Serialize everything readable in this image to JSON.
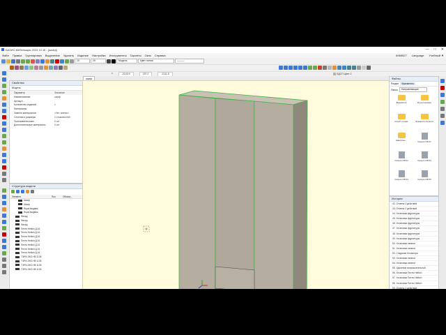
{
  "window": {
    "title": "БАЗИС-Мебельщик 2023 10.16 - [шкаф]",
    "minimize": "—",
    "maximize": "□",
    "close": "✕"
  },
  "menu": {
    "items": [
      "Файл",
      "Правка",
      "Группировка",
      "Выделение",
      "Удалить",
      "Изделие",
      "Настройки",
      "Инструменты",
      "Скрипты",
      "Окно",
      "Справка"
    ],
    "right": [
      "6969527",
      "Language",
      "Учебный ▼"
    ]
  },
  "toolbar": {
    "font_size": "10",
    "line_weight": "20",
    "mode": "Модель",
    "line_color_label": "Цвет линии"
  },
  "coords": {
    "x_label": "x",
    "x": "-2143.9",
    "y": "157.2",
    "z": "-2111.5"
  },
  "info_tab": "ЛДСП Цвет 2",
  "document_tab": "шкаф",
  "properties": {
    "title": "Свойства",
    "subtitle": "Модель",
    "header_key": "Параметр",
    "header_val": "Значение",
    "rows": [
      {
        "k": "Наименование",
        "v": "шкаф"
      },
      {
        "k": "Артикул",
        "v": ""
      },
      {
        "k": "Количество изделий",
        "v": "1"
      },
      {
        "k": "Материалы",
        "v": ""
      },
      {
        "k": "Замена материалов",
        "v": "<Нет смены>"
      },
      {
        "k": "Сечения и размеры",
        "v": "0 стыковостей"
      },
      {
        "k": "Пользовательские",
        "v": "0 шт."
      },
      {
        "k": "Дополнительные материалы",
        "v": "0 шт."
      }
    ]
  },
  "model_tree": {
    "title": "Структура модели",
    "col_elements": "Элемент",
    "col_pos": "Поз.",
    "col_size": "Обозна...",
    "rows": [
      {
        "label": "Шкаф",
        "extra": ""
      },
      {
        "label": "Шкаф",
        "extra": ""
      },
      {
        "label": "Ящик выдвиж.",
        "extra": ""
      },
      {
        "label": "Ящик выдвиж.",
        "extra": ""
      },
      {
        "label": "Фасад",
        "extra": ""
      },
      {
        "label": "Фасад",
        "extra": ""
      },
      {
        "label": "Фасад",
        "extra": ""
      },
      {
        "label": "Петля Hettich Д.16",
        "extra": ""
      },
      {
        "label": "Петля Hettich Д.16",
        "extra": ""
      },
      {
        "label": "Петля Hettich Д.16",
        "extra": ""
      },
      {
        "label": "Петля Hettich Д.16",
        "extra": ""
      },
      {
        "label": "Петля Hettich Д.16",
        "extra": ""
      },
      {
        "label": "Петля Hettich Д.16",
        "extra": ""
      },
      {
        "label": "Петля Hettich Д.16",
        "extra": ""
      },
      {
        "label": "ТЭРИ-ЭКО НВ 1135",
        "extra": ""
      },
      {
        "label": "ТЭРИ-ЭКО НВ 1135",
        "extra": ""
      },
      {
        "label": "ТЭРИ-ЭКО НВ 1135",
        "extra": ""
      },
      {
        "label": "ТЭРИ-ЭКО НВ 1135",
        "extra": ""
      }
    ]
  },
  "files": {
    "title": "Файлы",
    "tabs": [
      "Раздел",
      "Фрагменты"
    ],
    "folder_label": "Папка",
    "folder_value": "Направляющие",
    "items": [
      {
        "label": "Выемка Hi",
        "type": "folder"
      },
      {
        "label": "Мультишкафы",
        "type": "folder"
      },
      {
        "label": "Короб и ящик",
        "type": "folder"
      },
      {
        "label": "Элементы мультишкафа",
        "type": "folder"
      },
      {
        "label": "Навесные...",
        "type": "folder"
      },
      {
        "label": "Секции ОВ 01",
        "type": "cabinet"
      },
      {
        "label": "Секция ОВ 02",
        "type": "cabinet"
      },
      {
        "label": "Секция ОВ 03",
        "type": "cabinet"
      },
      {
        "label": "Секция ОВ 04",
        "type": "cabinet"
      },
      {
        "label": "Секция ОВ 05",
        "type": "cabinet"
      }
    ]
  },
  "history": {
    "title": "История",
    "rows": [
      "42. Отмена 2 действий",
      "43. Отмена 2 действий",
      "44. Установка фурнитуры",
      "45. Установка фурнитуры",
      "46. Установка фурнитуры",
      "47. Установка фурнитуры",
      "48. Установка фурнитуры",
      "49. Установка фурнитуры",
      "50. Установка панели",
      "51. Установка панели",
      "52. Создание блока/пра",
      "53. Установка панели",
      "54. Установка панели",
      "55. Удаление вспомогательной",
      "56. Установка Петли Hettich",
      "57. Установка Петли Hettich",
      "58. Установка Петли Hettich",
      "59. Отмена 2 действий",
      "60. Установка ТЭРИ-ЭКО",
      "61. Установка ТЭРИ-ЭКО",
      "62. Перемещение объектов"
    ]
  },
  "colors": {
    "viewport_bg": "#fffbdc",
    "cabinet": "#b5aea0",
    "selection_edge": "#3cb043",
    "accent": "#2f6fbf"
  }
}
